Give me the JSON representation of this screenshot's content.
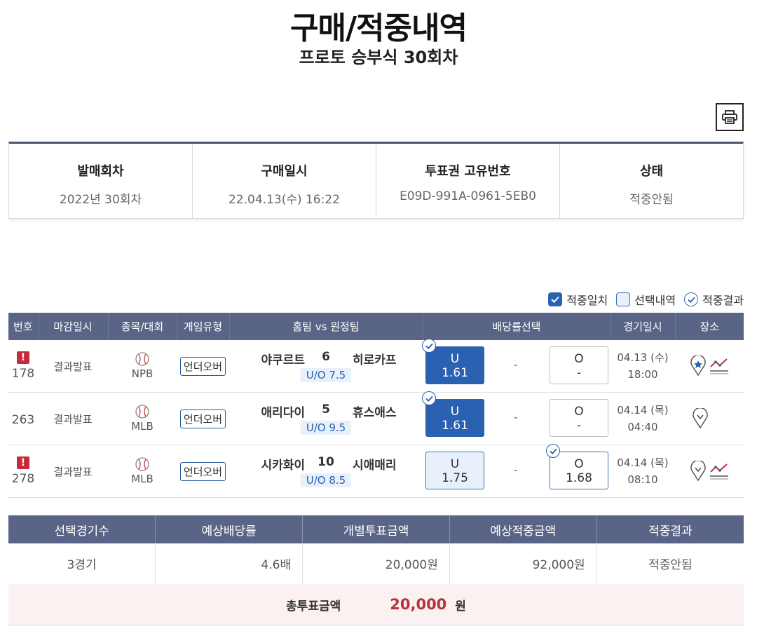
{
  "header": {
    "title": "구매/적중내역",
    "subtitle": "프로토 승부식 30회차"
  },
  "info": [
    {
      "label": "발매회차",
      "value": "2022년 30회차"
    },
    {
      "label": "구매일시",
      "value": "22.04.13(수) 16:22"
    },
    {
      "label": "투표권 고유번호",
      "value": "E09D-991A-0961-5EB0"
    },
    {
      "label": "상태",
      "value": "적중안됨"
    }
  ],
  "legend": {
    "hit": "적중일치",
    "selected": "선택내역",
    "result": "적중결과"
  },
  "table_headers": [
    "번호",
    "마감일시",
    "종목/대회",
    "게임유형",
    "홈팀 vs 원정팀",
    "배당률선택",
    "경기일시",
    "장소"
  ],
  "games": [
    {
      "warn": "!",
      "num": "178",
      "deadline": "결과발표",
      "league": "NPB",
      "type": "언더오버",
      "home": "야쿠르트",
      "score": "6",
      "away": "히로카프",
      "uo": "U/O 7.5",
      "u_label": "U",
      "u_odd": "1.61",
      "dash": "-",
      "o_label": "O",
      "o_odd": "-",
      "date": "04.13 (수)",
      "time": "18:00"
    },
    {
      "warn": "",
      "num": "263",
      "deadline": "결과발표",
      "league": "MLB",
      "type": "언더오버",
      "home": "애리다이",
      "score": "5",
      "away": "휴스애스",
      "uo": "U/O 9.5",
      "u_label": "U",
      "u_odd": "1.61",
      "dash": "-",
      "o_label": "O",
      "o_odd": "-",
      "date": "04.14 (목)",
      "time": "04:40"
    },
    {
      "warn": "!",
      "num": "278",
      "deadline": "결과발표",
      "league": "MLB",
      "type": "언더오버",
      "home": "시카화이",
      "score": "10",
      "away": "시애매리",
      "uo": "U/O 8.5",
      "u_label": "U",
      "u_odd": "1.75",
      "dash": "-",
      "o_label": "O",
      "o_odd": "1.68",
      "date": "04.14 (목)",
      "time": "08:10"
    }
  ],
  "summary": {
    "headers": [
      "선택경기수",
      "예상배당률",
      "개별투표금액",
      "예상적중금액",
      "적중결과"
    ],
    "values": [
      "3경기",
      "4.6배",
      "20,000원",
      "92,000원",
      "적중안됨"
    ]
  },
  "total": {
    "label": "총투표금액",
    "amount": "20,000",
    "unit": "원"
  },
  "colors": {
    "header_bg": "#5a6487",
    "hit": "#2a61b0",
    "total_amount": "#b6343f"
  },
  "icons": [
    "print-icon",
    "baseball-icon",
    "location-pin-icon",
    "chart-trend-icon",
    "check-icon",
    "warning-icon"
  ]
}
